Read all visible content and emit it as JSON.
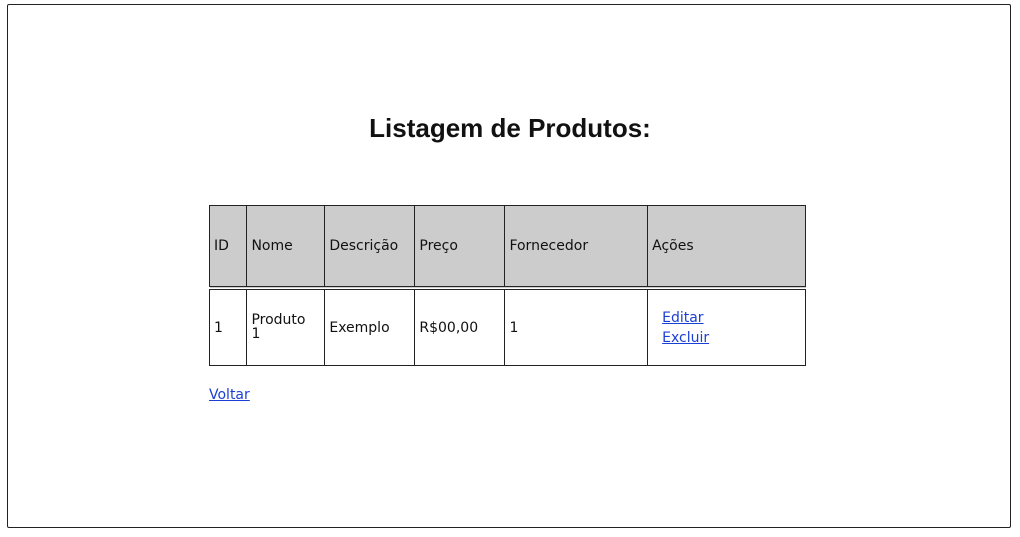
{
  "page": {
    "title": "Listagem de Produtos:"
  },
  "table": {
    "headers": {
      "id": "ID",
      "nome": "Nome",
      "descricao": "Descrição",
      "preco": "Preço",
      "fornecedor": "Fornecedor",
      "acoes": "Ações"
    },
    "rows": [
      {
        "id": "1",
        "nome": "Produto 1",
        "descricao": "Exemplo",
        "preco": "R$00,00",
        "fornecedor": "1",
        "edit_label": "Editar",
        "delete_label": "Excluir"
      }
    ]
  },
  "nav": {
    "back_label": "Voltar"
  },
  "colors": {
    "header_bg": "#cccccc",
    "link": "#1a3fd6",
    "border": "#222222"
  }
}
